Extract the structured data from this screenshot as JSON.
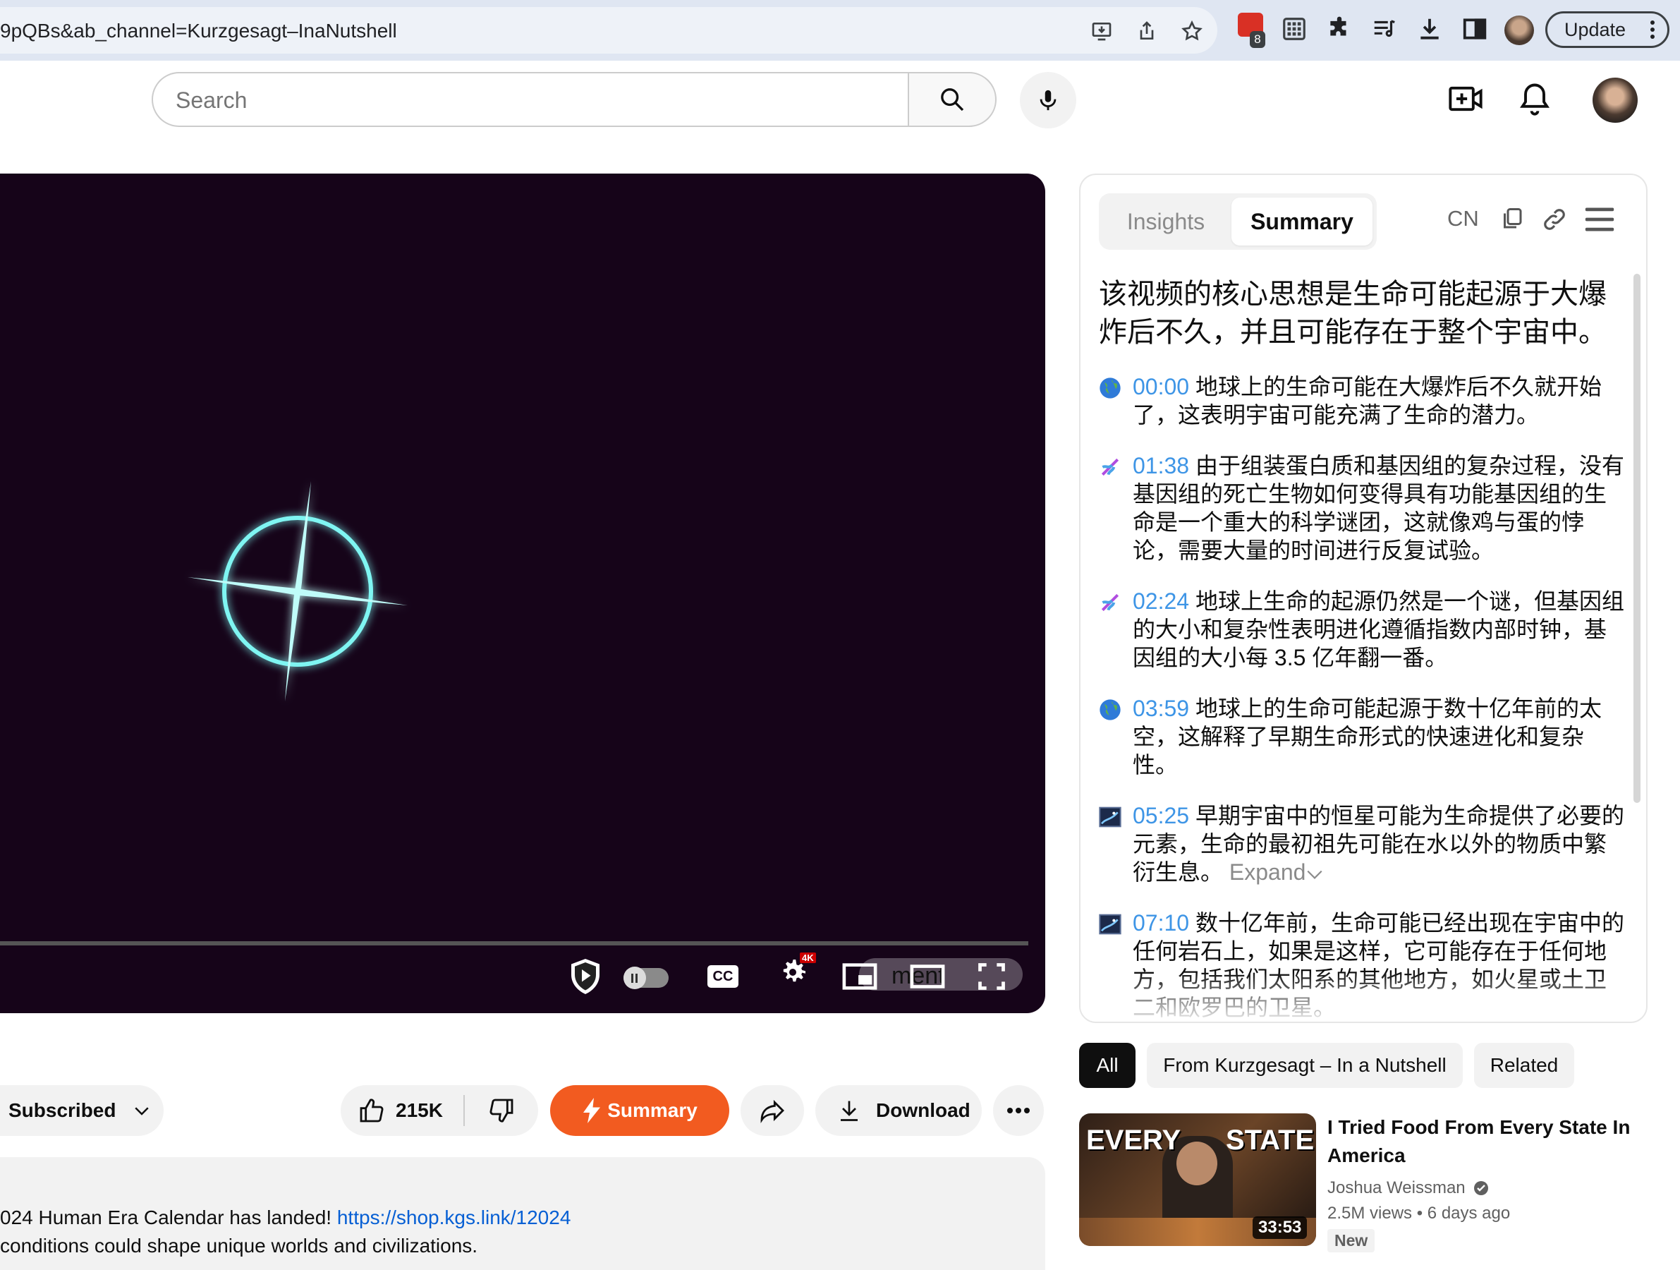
{
  "browser": {
    "url": "9pQBs&ab_channel=Kurzgesagt–InaNutshell",
    "extension_badge_count": "8",
    "update_label": "Update",
    "icons": [
      "install-icon",
      "share-icon",
      "bookmark-star-icon",
      "extension-badge-icon",
      "grid-icon",
      "puzzle-icon",
      "reading-list-icon",
      "download-icon",
      "side-panel-icon",
      "profile-avatar",
      "kebab-menu-icon"
    ]
  },
  "masthead": {
    "search_placeholder": "Search",
    "icons": [
      "search-icon",
      "mic-icon",
      "create-video-icon",
      "bell-icon",
      "avatar"
    ]
  },
  "player": {
    "overlay_label": "ment",
    "background_color": "#160419",
    "glow_color": "#7ff5f2",
    "controls": [
      "shield-play-icon",
      "autoplay-toggle",
      "cc-icon",
      "settings-icon",
      "miniplayer-icon",
      "theater-icon",
      "fullscreen-icon"
    ],
    "settings_badge": "4K",
    "cc_label": "CC"
  },
  "actions": {
    "subscribed_label": "Subscribed",
    "like_count": "215K",
    "summary_label": "Summary",
    "download_label": "Download"
  },
  "description": {
    "line1_prefix": "024 Human Era Calendar has landed! ",
    "line1_link": "https://shop.kgs.link/12024",
    "line2": "conditions could shape unique worlds and civilizations."
  },
  "panel": {
    "tabs": [
      {
        "label": "Insights"
      },
      {
        "label": "Summary"
      }
    ],
    "active_tab": "Summary",
    "lang_label": "CN",
    "headline": "该视频的核心思想是生命可能起源于大爆炸后不久，并且可能存在于整个宇宙中。",
    "items": [
      {
        "icon": "globe-icon",
        "ts": "00:00",
        "text": "地球上的生命可能在大爆炸后不久就开始了，这表明宇宙可能充满了生命的潜力。"
      },
      {
        "icon": "dna-icon",
        "ts": "01:38",
        "text": "由于组装蛋白质和基因组的复杂过程，没有基因组的死亡生物如何变得具有功能基因组的生命是一个重大的科学谜团，这就像鸡与蛋的悖论，需要大量的时间进行反复试验。"
      },
      {
        "icon": "dna-icon",
        "ts": "02:24",
        "text": "地球上生命的起源仍然是一个谜，但基因组的大小和复杂性表明进化遵循指数内部时钟，基因组的大小每 3.5 亿年翻一番。"
      },
      {
        "icon": "globe-icon",
        "ts": "03:59",
        "text": "地球上的生命可能起源于数十亿年前的太空，这解释了早期生命形式的快速进化和复杂性。"
      },
      {
        "icon": "space-image-icon",
        "ts": "05:25",
        "text": "早期宇宙中的恒星可能为生命提供了必要的元素，生命的最初祖先可能在水以外的物质中繁衍生息。",
        "expand": "Expand"
      },
      {
        "icon": "space-image-icon",
        "ts": "07:10",
        "text": "数十亿年前，生命可能已经出现在宇宙中的任何岩石上，如果是这样，它可能存在于任何地方，包括我们太阳系的其他地方，如火星或土卫二和欧罗巴的卫星。"
      }
    ]
  },
  "chips": [
    {
      "label": "All",
      "active": true
    },
    {
      "label": "From Kurzgesagt – In a Nutshell",
      "active": false
    },
    {
      "label": "Related",
      "active": false
    }
  ],
  "recommendation": {
    "thumb_text_left": "EVERY",
    "thumb_text_right": "STATE",
    "duration": "33:53",
    "title": "I Tried Food From Every State In America",
    "channel": "Joshua Weissman",
    "views": "2.5M views",
    "age": "6 days ago",
    "badge": "New"
  }
}
